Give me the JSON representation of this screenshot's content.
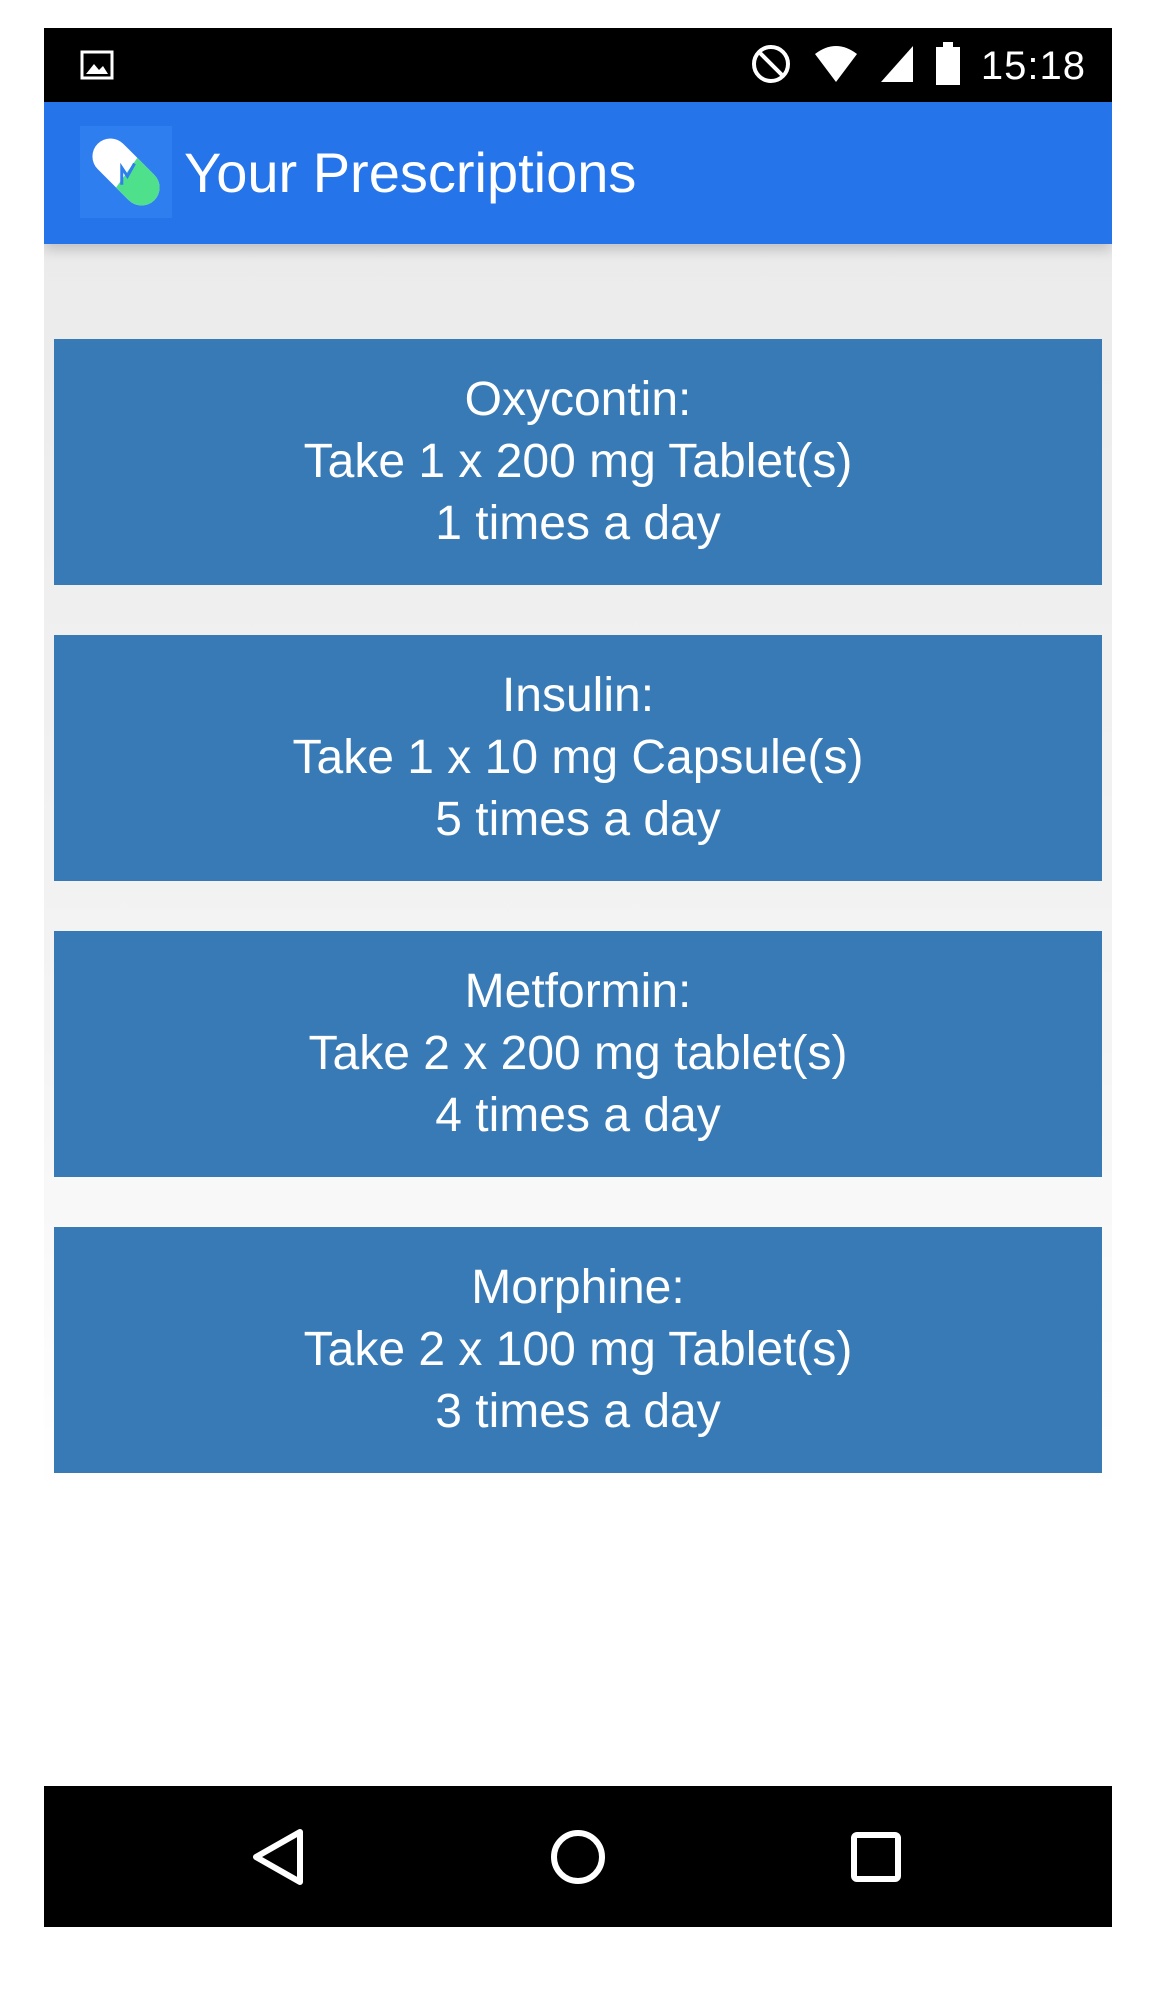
{
  "status_bar": {
    "time": "15:18",
    "icons": [
      "image-notification-icon",
      "do-not-disturb-icon",
      "wifi-icon",
      "cell-signal-icon",
      "battery-icon"
    ]
  },
  "app_bar": {
    "title": "Your Prescriptions",
    "logo_icon": "pill-capsule-icon",
    "color": "#2574ea"
  },
  "prescriptions": [
    {
      "name": "Oxycontin:",
      "dose": "Take 1 x 200 mg Tablet(s)",
      "frequency": "1 times a day"
    },
    {
      "name": "Insulin:",
      "dose": "Take 1 x 10 mg Capsule(s)",
      "frequency": "5 times a day"
    },
    {
      "name": "Metformin:",
      "dose": "Take 2 x 200 mg tablet(s)",
      "frequency": "4 times a day"
    },
    {
      "name": "Morphine:",
      "dose": "Take 2 x 100 mg Tablet(s)",
      "frequency": "3 times a day"
    }
  ],
  "card_color": "#377ab6",
  "nav_bar": {
    "buttons": [
      "back-icon",
      "home-icon",
      "recents-icon"
    ]
  }
}
